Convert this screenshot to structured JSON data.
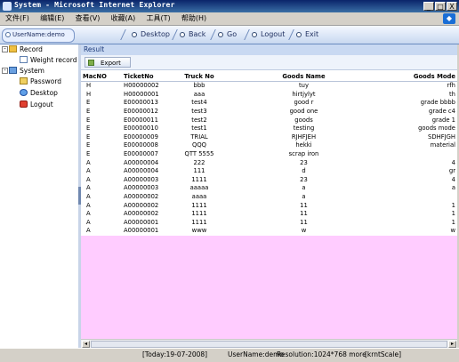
{
  "window": {
    "title": "System - Microsoft Internet Explorer"
  },
  "window_buttons": [
    "_",
    "□",
    "X"
  ],
  "menu": [
    "文件(F)",
    "编辑(E)",
    "查看(V)",
    "收藏(A)",
    "工具(T)",
    "帮助(H)"
  ],
  "toolbar": {
    "user": "UserName:demo",
    "nav": [
      "Desktop",
      "Back",
      "Go",
      "Logout",
      "Exit"
    ]
  },
  "sidebar": {
    "groups": [
      {
        "label": "Record",
        "items": [
          {
            "label": "Weight record",
            "icon": "document-icon"
          }
        ]
      },
      {
        "label": "System",
        "items": [
          {
            "label": "Password",
            "icon": "key-icon"
          },
          {
            "label": "Desktop",
            "icon": "desktop-icon"
          },
          {
            "label": "Logout",
            "icon": "logout-icon"
          }
        ]
      }
    ]
  },
  "main": {
    "panel_title": "Result",
    "export_label": "Export",
    "columns": [
      "MacNO",
      "TicketNo",
      "Truck No",
      "Goods Name",
      "Goods Mode"
    ],
    "rows": [
      [
        "H",
        "H00000002",
        "bbb",
        "tuy",
        "rfh"
      ],
      [
        "H",
        "H00000001",
        "aaa",
        "hirtjylyt",
        "th"
      ],
      [
        "E",
        "E00000013",
        "test4",
        "good r",
        "grade bbbb"
      ],
      [
        "E",
        "E00000012",
        "test3",
        "good one",
        "grade c4"
      ],
      [
        "E",
        "E00000011",
        "test2",
        "goods",
        "grade 1"
      ],
      [
        "E",
        "E00000010",
        "test1",
        "testing",
        "goods mode"
      ],
      [
        "E",
        "E00000009",
        "TRIAL",
        "RJHFJEH",
        "SDHFJGH"
      ],
      [
        "E",
        "E00000008",
        "QQQ",
        "hekki",
        "material"
      ],
      [
        "E",
        "E00000007",
        "QTT 5555",
        "scrap iron",
        ""
      ],
      [
        "A",
        "A00000004",
        "222",
        "23",
        "4"
      ],
      [
        "A",
        "A00000004",
        "111",
        "d",
        "gr"
      ],
      [
        "A",
        "A00000003",
        "1111",
        "23",
        "4"
      ],
      [
        "A",
        "A00000003",
        "aaaaa",
        "a",
        "a"
      ],
      [
        "A",
        "A00000002",
        "aaaa",
        "a",
        ""
      ],
      [
        "A",
        "A00000002",
        "1111",
        "11",
        "1"
      ],
      [
        "A",
        "A00000002",
        "1111",
        "11",
        "1"
      ],
      [
        "A",
        "A00000001",
        "1111",
        "11",
        "1"
      ],
      [
        "A",
        "A00000001",
        "www",
        "w",
        "w"
      ]
    ]
  },
  "status": {
    "today": "[Today:19-07-2008]",
    "user": "UserName:demo",
    "resolution": "Resolution:1024*768 more",
    "scale": "[krntScale]"
  }
}
